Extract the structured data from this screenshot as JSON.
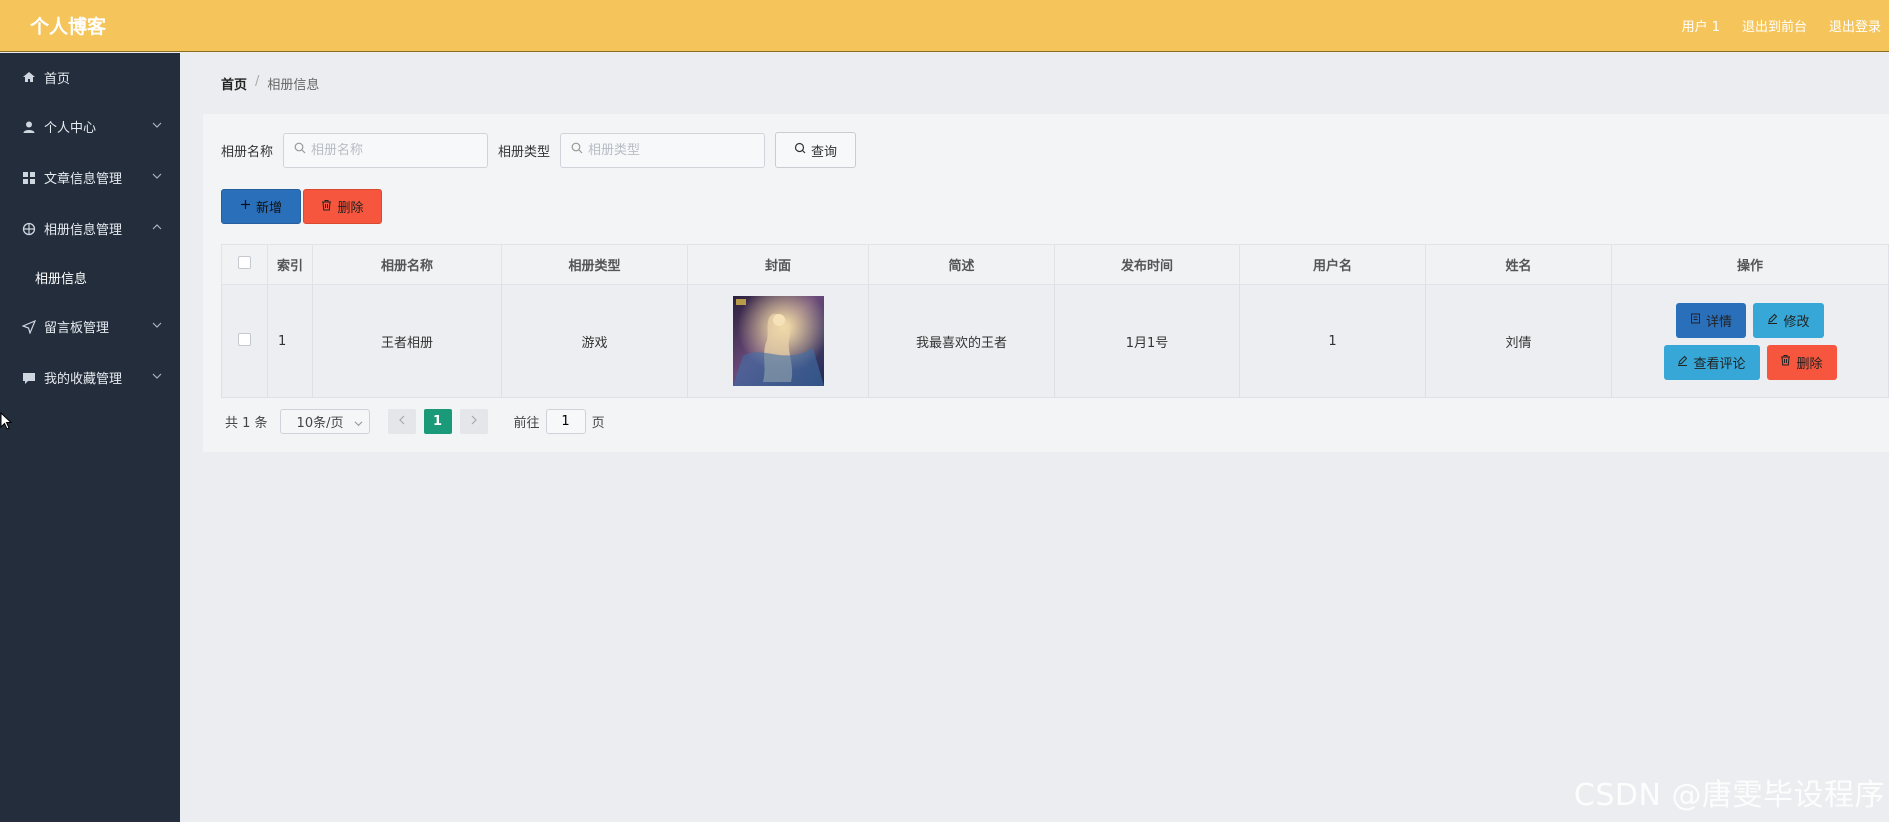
{
  "header": {
    "brand": "个人博客",
    "links": [
      "用户 1",
      "退出到前台",
      "退出登录"
    ]
  },
  "sidebar": {
    "items": [
      {
        "label": "首页",
        "icon": "home-icon"
      },
      {
        "label": "个人中心",
        "icon": "user-icon"
      },
      {
        "label": "文章信息管理",
        "icon": "grid-icon"
      },
      {
        "label": "相册信息管理",
        "icon": "crosshair-icon"
      },
      {
        "label": "留言板管理",
        "icon": "send-icon"
      },
      {
        "label": "我的收藏管理",
        "icon": "chat-icon"
      }
    ],
    "submenu": {
      "label": "相册信息"
    }
  },
  "breadcrumb": {
    "home": "首页",
    "separator": "/",
    "current": "相册信息"
  },
  "search": {
    "name_label": "相册名称",
    "name_placeholder": "相册名称",
    "type_label": "相册类型",
    "type_placeholder": "相册类型",
    "query_label": "查询"
  },
  "actions": {
    "add_label": "新增",
    "delete_label": "删除"
  },
  "table": {
    "headers": [
      "索引",
      "相册名称",
      "相册类型",
      "封面",
      "简述",
      "发布时间",
      "用户名",
      "姓名",
      "操作"
    ],
    "rows": [
      {
        "index": "1",
        "name": "王者相册",
        "type": "游戏",
        "summary": "我最喜欢的王者",
        "time": "1月1号",
        "username": "1",
        "realname": "刘倩"
      }
    ],
    "row_actions": {
      "detail": "详情",
      "edit": "修改",
      "comments": "查看评论",
      "delete": "删除"
    }
  },
  "pagination": {
    "total": "共 1 条",
    "page_size": "10条/页",
    "current_page": "1",
    "goto_label": "前往",
    "goto_value": "1",
    "page_suffix": "页"
  },
  "watermark": "CSDN @唐雯毕设程序",
  "colors": {
    "header_bg": "#f5c55b",
    "sidebar_bg": "#232d3b",
    "primary": "#2a6fb9",
    "danger": "#f5563d",
    "info": "#36a7d6",
    "pager_active": "#1a9a78"
  }
}
